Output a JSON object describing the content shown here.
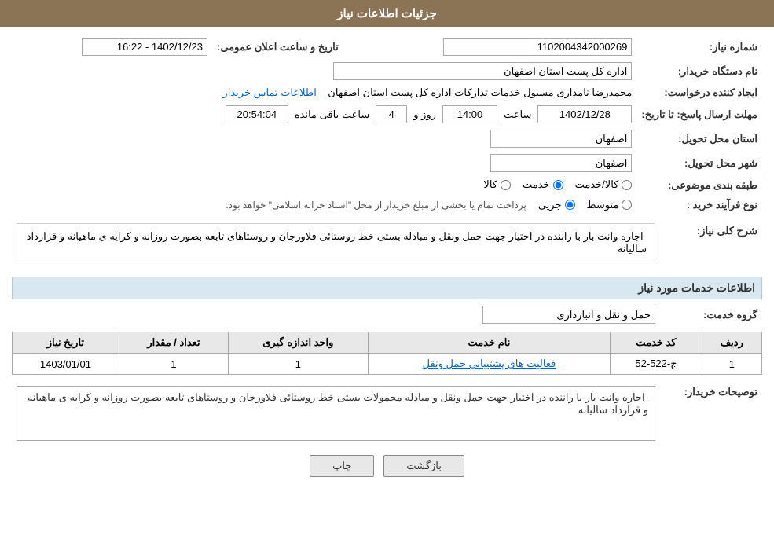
{
  "header": {
    "title": "جزئیات اطلاعات نیاز"
  },
  "fields": {
    "shomareNiaz_label": "شماره نیاز:",
    "shomareNiaz_value": "1102004342000269",
    "tarikhLabel": "تاریخ و ساعت اعلان عمومی:",
    "tarikhValue": "1402/12/23 - 16:22",
    "namDastgahLabel": "نام دستگاه خریدار:",
    "namDastgahValue": "اداره کل پست استان اصفهان",
    "ijadKanandaLabel": "ایجاد کننده درخواست:",
    "ijadKanandaValue": "محمدرضا نامداری مسیول خدمات تداركات اداره كل پست استان اصفهان",
    "ijadKanandaLink": "اطلاعات تماس خریدار",
    "mohlatLabel": "مهلت ارسال پاسخ: تا تاریخ:",
    "mohlatDate": "1402/12/28",
    "mohlatSaatLabel": "ساعت",
    "mohlatSaat": "14:00",
    "mohlatRozLabel": "روز و",
    "mohlatRoz": "4",
    "mohlatBaqiLabel": "ساعت باقی مانده",
    "mohlatBaqi": "20:54:04",
    "ostanTahvilLabel": "استان محل تحویل:",
    "ostanTahvilValue": "اصفهان",
    "shahrTahvilLabel": "شهر محل تحویل:",
    "shahrTahvilValue": "اصفهان",
    "tabagheBandiLabel": "طبقه بندی موضوعی:",
    "tabagheBandiKala": "کالا",
    "tabagheBandiKhadamat": "خدمت",
    "tabagheBandiKalaKhadamat": "کالا/خدمت",
    "noeFarayandLabel": "نوع فرآیند خرید :",
    "noeFarayandJozvi": "جزیی",
    "noeFarayandMotavasset": "متوسط",
    "noeFarayandDesc": "پرداخت تمام یا بخشی از مبلغ خریدار از محل \"اسناد خزانه اسلامی\" خواهد بود."
  },
  "sharhKolli": {
    "label": "شرح کلی نیاز:",
    "value": "-اجاره وانت بار با راننده در اختیار جهت حمل ونقل و مبادله بستی خط روستائی فلاورجان و روستاهای تابعه بصورت روزانه و کرایه ی ماهیانه و قرارداد سالیانه"
  },
  "khadamatSection": {
    "title": "اطلاعات خدمات مورد نیاز",
    "groupLabel": "گروه خدمت:",
    "groupValue": "حمل و نقل و انبارداری",
    "tableHeaders": [
      "ردیف",
      "کد خدمت",
      "نام خدمت",
      "واحد اندازه گیری",
      "تعداد / مقدار",
      "تاریخ نیاز"
    ],
    "tableRows": [
      {
        "radif": "1",
        "kodKhadamat": "ج-522-52",
        "namKhadamat": "فعالیت های پشتیبانی حمل ونقل",
        "vahed": "1",
        "tedad": "1",
        "tarikh": "1403/01/01"
      }
    ]
  },
  "tosifatKhardar": {
    "label": "توصیحات خریدار:",
    "value": "-اجاره وانت بار با راننده در اختیار جهت حمل ونقل و مبادله مجمولات  بستی  خط روستائی فلاورجان و روستاهای تابعه بصورت روزانه و کرایه ی ماهیانه و قرارداد سالیانه"
  },
  "buttons": {
    "chap": "چاپ",
    "bazgasht": "بازگشت"
  }
}
